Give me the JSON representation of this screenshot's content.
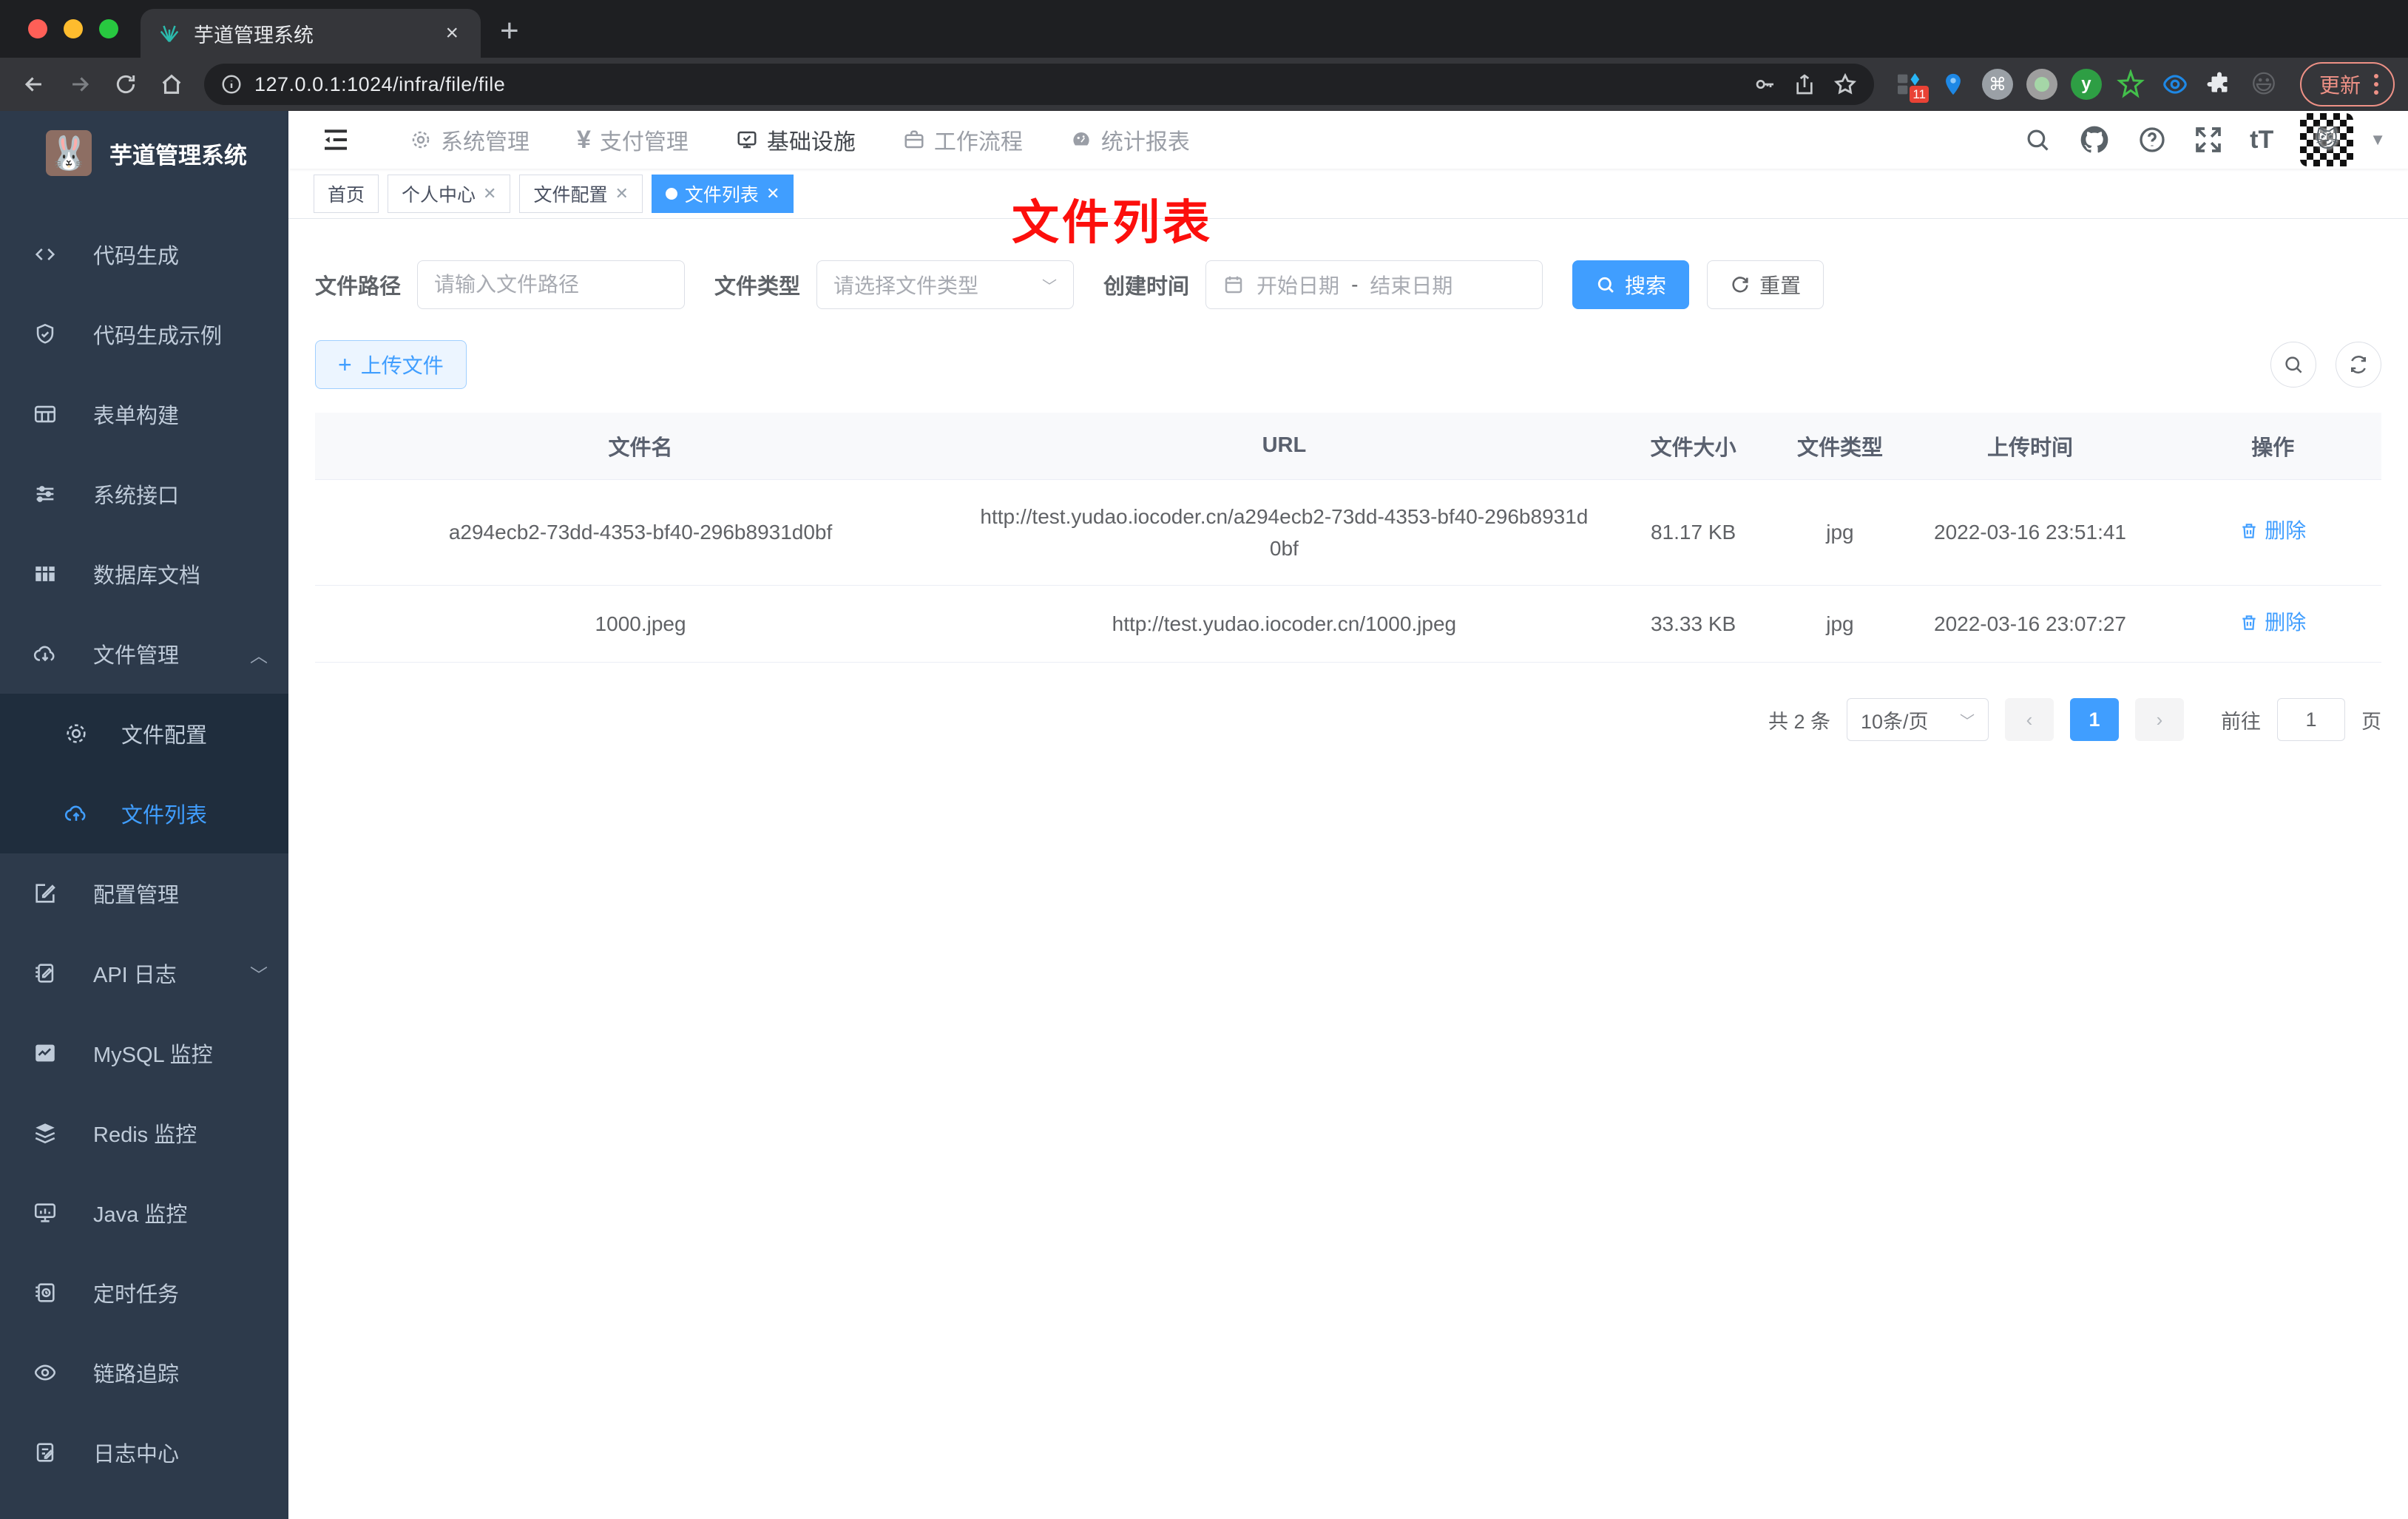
{
  "browser": {
    "tab": {
      "title": "芋道管理系统",
      "close": "×",
      "new_tab": "+"
    },
    "address": {
      "url": "127.0.0.1:1024/infra/file/file"
    },
    "extensions_badge": "11",
    "update_label": "更新"
  },
  "header": {
    "app_title": "芋道管理系统",
    "nav": [
      {
        "label": "系统管理"
      },
      {
        "label": "支付管理"
      },
      {
        "label": "基础设施"
      },
      {
        "label": "工作流程"
      },
      {
        "label": "统计报表"
      }
    ],
    "font_size_tool": "tT"
  },
  "sidebar": {
    "items": [
      {
        "label": "代码生成"
      },
      {
        "label": "代码生成示例"
      },
      {
        "label": "表单构建"
      },
      {
        "label": "系统接口"
      },
      {
        "label": "数据库文档"
      },
      {
        "label": "文件管理"
      },
      {
        "label": "文件配置"
      },
      {
        "label": "文件列表"
      },
      {
        "label": "配置管理"
      },
      {
        "label": "API 日志"
      },
      {
        "label": "MySQL 监控"
      },
      {
        "label": "Redis 监控"
      },
      {
        "label": "Java 监控"
      },
      {
        "label": "定时任务"
      },
      {
        "label": "链路追踪"
      },
      {
        "label": "日志中心"
      }
    ]
  },
  "tags": [
    {
      "label": "首页"
    },
    {
      "label": "个人中心"
    },
    {
      "label": "文件配置"
    },
    {
      "label": "文件列表"
    }
  ],
  "annotation": "文件列表",
  "filters": {
    "path_label": "文件路径",
    "path_placeholder": "请输入文件路径",
    "type_label": "文件类型",
    "type_placeholder": "请选择文件类型",
    "date_label": "创建时间",
    "date_start": "开始日期",
    "date_separator": "-",
    "date_end": "结束日期",
    "search_label": "搜索",
    "reset_label": "重置"
  },
  "toolbar": {
    "upload_label": "上传文件"
  },
  "table": {
    "headers": [
      "文件名",
      "URL",
      "文件大小",
      "文件类型",
      "上传时间",
      "操作"
    ],
    "rows": [
      {
        "name": "a294ecb2-73dd-4353-bf40-296b8931d0bf",
        "url": "http://test.yudao.iocoder.cn/a294ecb2-73dd-4353-bf40-296b8931d0bf",
        "size": "81.17 KB",
        "type": "jpg",
        "time": "2022-03-16 23:51:41",
        "action": "删除"
      },
      {
        "name": "1000.jpeg",
        "url": "http://test.yudao.iocoder.cn/1000.jpeg",
        "size": "33.33 KB",
        "type": "jpg",
        "time": "2022-03-16 23:07:27",
        "action": "删除"
      }
    ]
  },
  "pagination": {
    "total": "共 2 条",
    "page_size": "10条/页",
    "current_page": "1",
    "goto_label": "前往",
    "goto_value": "1",
    "unit_label": "页"
  },
  "colors": {
    "accent": "#409eff",
    "sidebar_bg": "#2d3a4b",
    "submenu_bg": "#1f2d3d",
    "annotation": "#fc0f0c"
  }
}
